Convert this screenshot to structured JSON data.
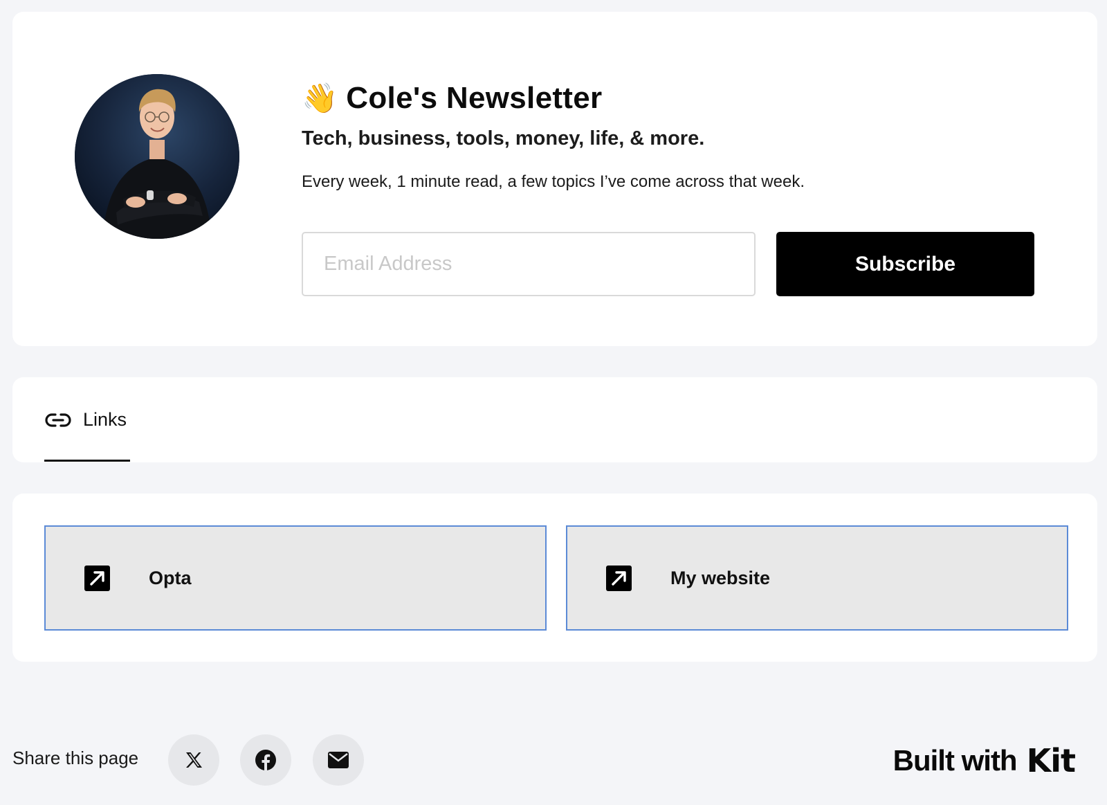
{
  "hero": {
    "wave_emoji": "👋",
    "title": "Cole's Newsletter",
    "subtitle": "Tech, business, tools, money, life, & more.",
    "description": "Every week, 1 minute read, a few topics I’ve come across that week.",
    "email_placeholder": "Email Address",
    "email_value": "",
    "subscribe_label": "Subscribe"
  },
  "tabs": [
    {
      "label": "Links",
      "icon": "link-icon",
      "active": true
    }
  ],
  "links": [
    {
      "label": "Opta",
      "icon": "external-link-icon"
    },
    {
      "label": "My website",
      "icon": "external-link-icon"
    }
  ],
  "footer": {
    "share_label": "Share this page",
    "share_buttons": [
      {
        "icon": "x-icon"
      },
      {
        "icon": "facebook-icon"
      },
      {
        "icon": "mail-icon"
      }
    ],
    "built_with": "Built with",
    "brand": "Kit"
  },
  "colors": {
    "page_background": "#f4f5f8",
    "card_background": "#ffffff",
    "button_primary": "#000000",
    "link_card_background": "#e8e8e8",
    "link_card_border": "#5b8ad6"
  }
}
